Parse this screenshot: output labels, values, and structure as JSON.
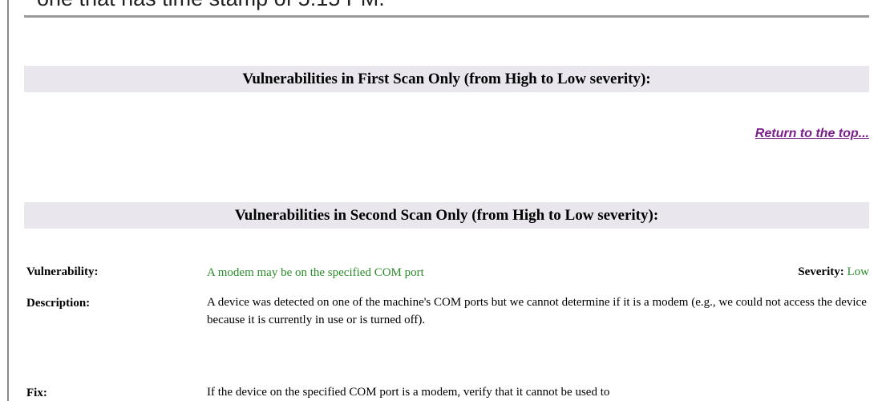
{
  "caption": {
    "text": "one that has time stamp of 5:15 PM."
  },
  "sections": [
    {
      "title": "Vulnerabilities in First Scan Only (from High to Low severity):"
    },
    {
      "title": "Vulnerabilities in Second Scan Only (from High to Low severity):"
    }
  ],
  "return_link": {
    "label": "Return to the top..."
  },
  "vulnerability": {
    "vulnerability_label": "Vulnerability:",
    "vulnerability_value": "A modem may be on the specified COM port",
    "severity_label": "Severity:",
    "severity_value": "Low",
    "description_label": "Description:",
    "description_value": "A device was detected on one of the machine's COM ports but we cannot determine if it is a modem (e.g., we could not access the device because it is currently in use or is turned off).",
    "fix_label": "Fix:",
    "fix_value": "If the device on the specified COM port is a modem, verify that it cannot be used to"
  },
  "colors": {
    "section_header_bg": "#e9e6ee",
    "link": "#7a1f8c",
    "vulnerability_text": "#2e8b2e"
  }
}
